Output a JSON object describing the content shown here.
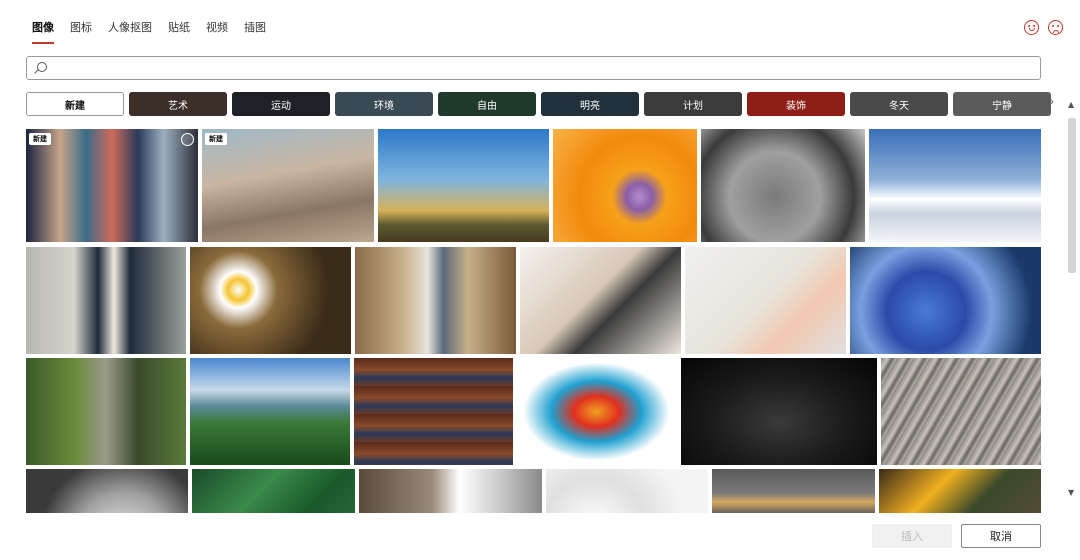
{
  "tabs": [
    {
      "label": "图像",
      "active": true
    },
    {
      "label": "图标",
      "active": false
    },
    {
      "label": "人像抠图",
      "active": false
    },
    {
      "label": "贴纸",
      "active": false
    },
    {
      "label": "视频",
      "active": false
    },
    {
      "label": "插图",
      "active": false
    }
  ],
  "header_icons": [
    "smile-feedback-icon",
    "frown-feedback-icon"
  ],
  "search": {
    "value": "",
    "placeholder": ""
  },
  "categories": [
    {
      "label": "新建",
      "bg": "#ffffff"
    },
    {
      "label": "艺术",
      "bg": "#3c2f2a"
    },
    {
      "label": "运动",
      "bg": "#1f2126"
    },
    {
      "label": "环境",
      "bg": "#3a4a55"
    },
    {
      "label": "自由",
      "bg": "#1f3a2a"
    },
    {
      "label": "明亮",
      "bg": "#22303b"
    },
    {
      "label": "计划",
      "bg": "#3b3b3b"
    },
    {
      "label": "装饰",
      "bg": "#8e1f16"
    },
    {
      "label": "冬天",
      "bg": "#4a4a4a"
    },
    {
      "label": "宁静",
      "bg": "#5b5b5b"
    }
  ],
  "images": [
    {
      "name": "colorful-book-spines",
      "bg": "linear-gradient(90deg,#1b2440,#c9a48a 20%,#3a6b8a 35%,#d06a5a 50%,#2a3a5a 65%,#9cb0c0 80%,#2d2d3a)",
      "badge": "新建",
      "selectable": true
    },
    {
      "name": "coastline-aerial",
      "bg": "linear-gradient(170deg,#9fb8c8,#c9b7a3 40%,#8a7664 70%,#bba68f)",
      "badge": "新建",
      "selectable": false
    },
    {
      "name": "desert-cactus",
      "bg": "linear-gradient(180deg,#2d78c8,#7fb5e0 45%,#d8b25a 72%,#5a5a30 85%,#4a3a20)",
      "badge": "",
      "selectable": false
    },
    {
      "name": "orange-nautilus-shell",
      "bg": "radial-gradient(circle at 60% 60%,#b78bd0 0,#8a5fa8 12%,#f7a11a 25%,#f28a0c 55%,#f9b24a)",
      "badge": "",
      "selectable": false
    },
    {
      "name": "skatepark-bowl",
      "bg": "radial-gradient(circle at 45% 60%,#7a7a7a,#a0a0a0 40%,#3a3a3a 70%,#c8c8c8)",
      "badge": "",
      "selectable": false
    },
    {
      "name": "snowy-mountains",
      "bg": "linear-gradient(180deg,#3a6fb8,#8fb0d8 45%,#ffffff 62%,#c8d2de 75%,#f4f6f8)",
      "badge": "",
      "selectable": false
    },
    {
      "name": "business-woman-portrait",
      "bg": "linear-gradient(90deg,#b7b7b2,#d8d4cc 30%,#1f2a3a 45%,#f0e8e0 55%,#1f2a3a 65%,#9aa09a)",
      "badge": "",
      "selectable": false
    },
    {
      "name": "daisy-flowers",
      "bg": "radial-gradient(circle at 30% 40%,#ffffff 0,#f4c430 8%,#ffffff 14%,#8a6a3a 30%,#3a2a18 70%)",
      "badge": "",
      "selectable": false
    },
    {
      "name": "lumber-warehouse-worker",
      "bg": "linear-gradient(90deg,#8a6a4a,#c8b08a 30%,#e8e4dc 45%,#5a6a7a 55%,#c8b08a 70%,#7a5a3a)",
      "badge": "",
      "selectable": false
    },
    {
      "name": "modern-lounge-chairs",
      "bg": "linear-gradient(135deg,#f5f2ee,#d8c8b8 45%,#3a3a3a 60%,#ece6de)",
      "badge": "",
      "selectable": false
    },
    {
      "name": "hand-holding-phone",
      "bg": "linear-gradient(135deg,#f0f0ee,#e8e4dc 50%,#f2c8b0 70%,#e0e0e0)",
      "badge": "",
      "selectable": false
    },
    {
      "name": "blue-flower-field",
      "bg": "radial-gradient(circle at 40% 60%,#4a7ad8,#2a4aa8 30%,#7aa0e0 50%,#1a3a6a 80%)",
      "badge": "",
      "selectable": false
    },
    {
      "name": "man-watering-plants",
      "bg": "linear-gradient(90deg,#3a5a2a,#6a8a3a 30%,#9a9a8a 50%,#3a4a2a 70%,#5a7a3a)",
      "badge": "",
      "selectable": false
    },
    {
      "name": "green-hills-coast",
      "bg": "linear-gradient(180deg,#4a8ad0,#c8d8e8 30%,#5a8a9a 45%,#3a7a3a 60%,#1a4a1a)",
      "badge": "",
      "selectable": false
    },
    {
      "name": "library-bookshelf",
      "bg": "repeating-linear-gradient(180deg,#5a2a1a 0,#8a4a2a 12px,#2a3a5a 20px,#6a3a2a 28px)",
      "badge": "",
      "selectable": false
    },
    {
      "name": "colorful-ink-splash",
      "bg": "radial-gradient(ellipse at 50% 50%,#f0a020 0,#e03020 20%,#20a0d0 40%,#ffffff 65%)",
      "badge": "",
      "selectable": false
    },
    {
      "name": "dark-abstract-swirl",
      "bg": "radial-gradient(ellipse at 50% 60%,#3a3a3a,#1a1a1a 50%,#050505)",
      "badge": "",
      "selectable": false
    },
    {
      "name": "wood-grain-texture",
      "bg": "repeating-linear-gradient(120deg,#8a8680 0,#c8c4bc 6px,#6a6660 10px,#b8b4ac 14px)",
      "badge": "",
      "selectable": false
    },
    {
      "name": "spiral-staircase",
      "bg": "radial-gradient(circle at 60% 120%,#f0f0f0,#a0a0a0 40%,#3a3a3a 70%)",
      "badge": "",
      "selectable": false
    },
    {
      "name": "green-leaves",
      "bg": "linear-gradient(135deg,#1a4a2a,#3a8a4a 40%,#1a5a2a 70%,#2a6a3a)",
      "badge": "",
      "selectable": false
    },
    {
      "name": "concrete-architecture",
      "bg": "linear-gradient(90deg,#5a4a3a,#9a8a7a 40%,#ffffff 55%,#cfcfcf 75%,#8a8a8a)",
      "badge": "",
      "selectable": false
    },
    {
      "name": "white-spiral-stairs",
      "bg": "radial-gradient(circle at 30% 100%,#ffffff,#e0e0e0 40%,#f4f4f4 70%)",
      "badge": "",
      "selectable": false
    },
    {
      "name": "baguette-bread",
      "bg": "linear-gradient(180deg,#5a5a5a,#7a7a7a 40%,#d8a860 55%,#5a5a5a 75%)",
      "badge": "",
      "selectable": false
    },
    {
      "name": "pumpkins-autumn",
      "bg": "linear-gradient(135deg,#3a2a1a,#f0b020 35%,#3a4a2a 60%,#5a4a3a)",
      "badge": "",
      "selectable": false
    }
  ],
  "buttons": {
    "insert": "插入",
    "cancel": "取消"
  },
  "nav": {
    "next_glyph": "›",
    "up_glyph": "▲",
    "down_glyph": "▼"
  }
}
